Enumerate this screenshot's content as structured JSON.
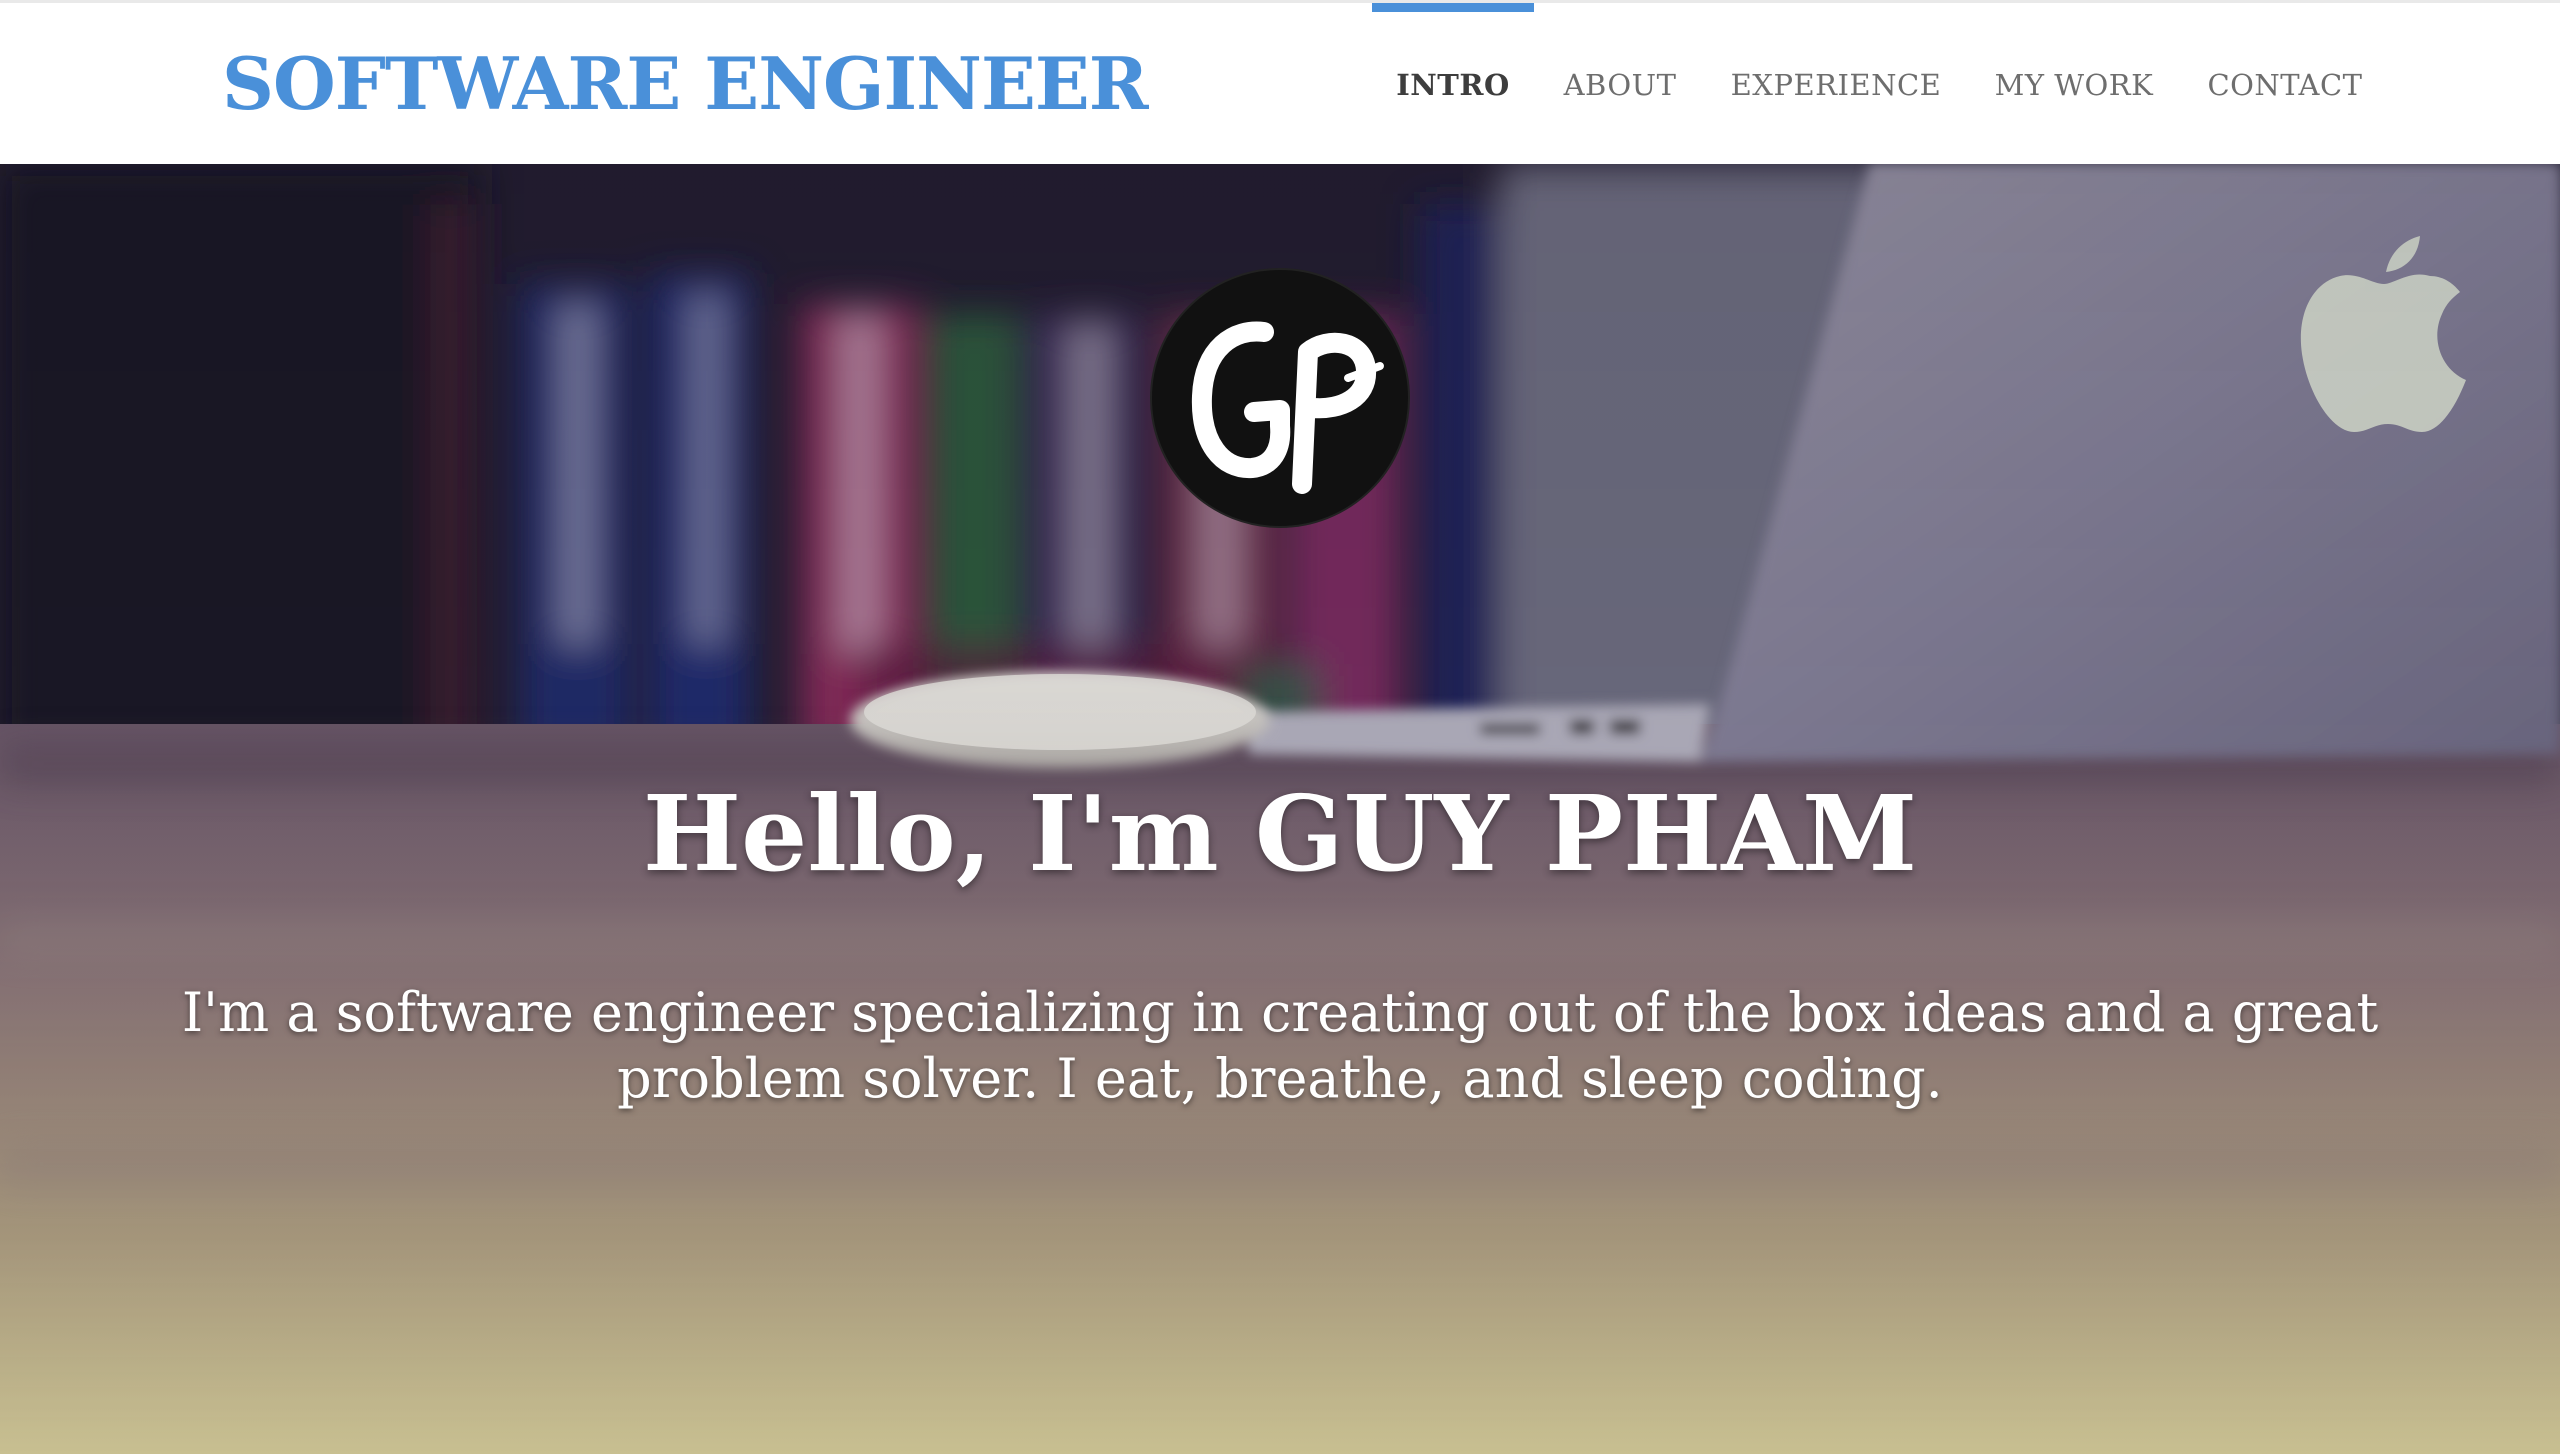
{
  "header": {
    "brand": "SOFTWARE ENGINEER",
    "nav": [
      {
        "label": "INTRO",
        "active": true
      },
      {
        "label": "ABOUT",
        "active": false
      },
      {
        "label": "EXPERIENCE",
        "active": false
      },
      {
        "label": "MY WORK",
        "active": false
      },
      {
        "label": "CONTACT",
        "active": false
      }
    ]
  },
  "hero": {
    "logo_text": "GP",
    "title": "Hello, I'm GUY PHAM",
    "subtitle": "I'm a software engineer specializing in creating out of the box ideas and a great problem solver. I eat, breathe, and sleep coding."
  },
  "colors": {
    "accent": "#4a90d9",
    "nav_active": "#3d3d3d",
    "nav_inactive": "#6e6e6e",
    "hero_text": "#ffffff"
  }
}
